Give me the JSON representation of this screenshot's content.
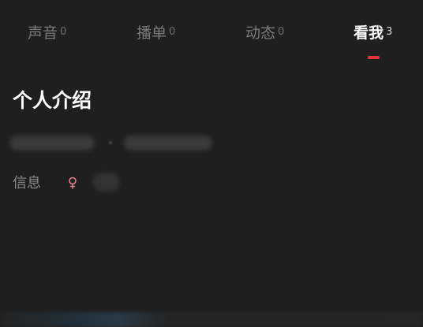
{
  "tabs": [
    {
      "label": "声音",
      "count": "0",
      "active": false
    },
    {
      "label": "播单",
      "count": "0",
      "active": false
    },
    {
      "label": "动态",
      "count": "0",
      "active": false
    },
    {
      "label": "看我",
      "count": "3",
      "active": true
    }
  ],
  "section": {
    "title": "个人介绍"
  },
  "info": {
    "label": "信息",
    "gender_icon": "female-icon"
  },
  "colors": {
    "background": "#1f1f1f",
    "accent": "#e8333c",
    "gender_icon": "#e07c90"
  }
}
